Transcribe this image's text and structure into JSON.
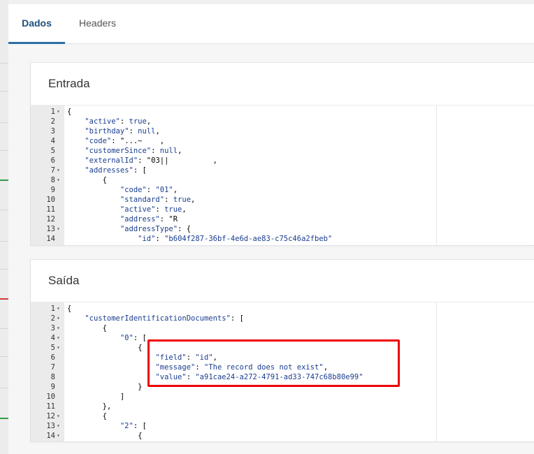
{
  "tabs": [
    {
      "label": "Dados",
      "active": true
    },
    {
      "label": "Headers",
      "active": false
    }
  ],
  "entrada": {
    "title": "Entrada",
    "lines": [
      {
        "n": "1",
        "fold": true,
        "code": "{"
      },
      {
        "n": "2",
        "fold": false,
        "code": "    \"active\": true,"
      },
      {
        "n": "3",
        "fold": false,
        "code": "    \"birthday\": null,"
      },
      {
        "n": "4",
        "fold": false,
        "code": "    \"code\": \"...~    ,"
      },
      {
        "n": "5",
        "fold": false,
        "code": "    \"customerSince\": null,"
      },
      {
        "n": "6",
        "fold": false,
        "code": "    \"externalId\": \"03||          ,"
      },
      {
        "n": "7",
        "fold": true,
        "code": "    \"addresses\": ["
      },
      {
        "n": "8",
        "fold": true,
        "code": "        {"
      },
      {
        "n": "9",
        "fold": false,
        "code": "            \"code\": \"01\","
      },
      {
        "n": "10",
        "fold": false,
        "code": "            \"standard\": true,"
      },
      {
        "n": "11",
        "fold": false,
        "code": "            \"active\": true,"
      },
      {
        "n": "12",
        "fold": false,
        "code": "            \"address\": \"R"
      },
      {
        "n": "13",
        "fold": true,
        "code": "            \"addressType\": {"
      },
      {
        "n": "14",
        "fold": false,
        "code": "                \"id\": \"b604f287-36bf-4e6d-ae83-c75c46a2fbeb\""
      }
    ]
  },
  "saida": {
    "title": "Saída",
    "lines": [
      {
        "n": "1",
        "fold": true,
        "code": "{"
      },
      {
        "n": "2",
        "fold": true,
        "code": "    \"customerIdentificationDocuments\": ["
      },
      {
        "n": "3",
        "fold": true,
        "code": "        {"
      },
      {
        "n": "4",
        "fold": true,
        "code": "            \"0\": ["
      },
      {
        "n": "5",
        "fold": true,
        "code": "                {"
      },
      {
        "n": "6",
        "fold": false,
        "code": "                    \"field\": \"id\","
      },
      {
        "n": "7",
        "fold": false,
        "code": "                    \"message\": \"The record does not exist\","
      },
      {
        "n": "8",
        "fold": false,
        "code": "                    \"value\": \"a91cae24-a272-4791-ad33-747c68b80e99\""
      },
      {
        "n": "9",
        "fold": false,
        "code": "                }"
      },
      {
        "n": "10",
        "fold": false,
        "code": "            ]"
      },
      {
        "n": "11",
        "fold": false,
        "code": "        },"
      },
      {
        "n": "12",
        "fold": true,
        "code": "        {"
      },
      {
        "n": "13",
        "fold": true,
        "code": "            \"2\": ["
      },
      {
        "n": "14",
        "fold": true,
        "code": "                {"
      }
    ]
  },
  "fold_glyph": "▾",
  "colors": {
    "tab_active": "#1f4f7a",
    "highlight_box": "#e00000",
    "json_value": "#1a3d8f"
  }
}
